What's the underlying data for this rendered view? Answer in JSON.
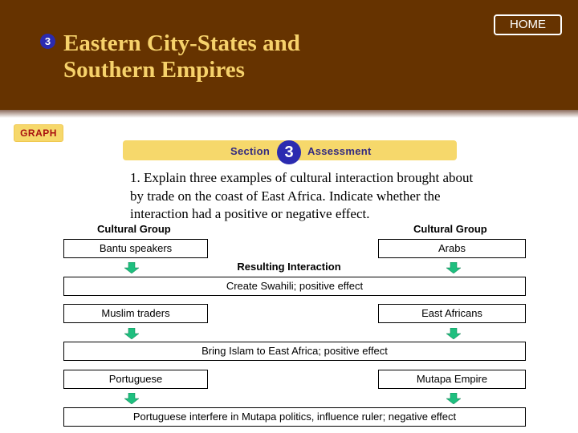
{
  "header": {
    "section_number": "3",
    "title_line1": "Eastern City-States and",
    "title_line2": "Southern Empires",
    "home_label": "HOME",
    "background_color": "#663300",
    "title_color": "#f6d26b"
  },
  "tag": {
    "label": "GRAPH"
  },
  "assessment_bar": {
    "section_label": "Section",
    "section_number": "3",
    "assessment_label": "Assessment"
  },
  "question": {
    "line1": "1. Explain three examples of cultural interaction brought about",
    "line2": "by trade on the coast of East Africa. Indicate whether the",
    "line3": "interaction had a positive or negative effect."
  },
  "diagram": {
    "left_header": "Cultural Group",
    "right_header": "Cultural Group",
    "result_header": "Resulting Interaction",
    "arrow_color": "#1fbf7f",
    "rows": [
      {
        "left": "Bantu speakers",
        "right": "Arabs",
        "result": "Create Swahili; positive effect"
      },
      {
        "left": "Muslim traders",
        "right": "East Africans",
        "result": "Bring Islam to East Africa; positive effect"
      },
      {
        "left": "Portuguese",
        "right": "Mutapa Empire",
        "result": "Portuguese interfere in Mutapa politics, influence ruler; negative effect"
      }
    ]
  }
}
